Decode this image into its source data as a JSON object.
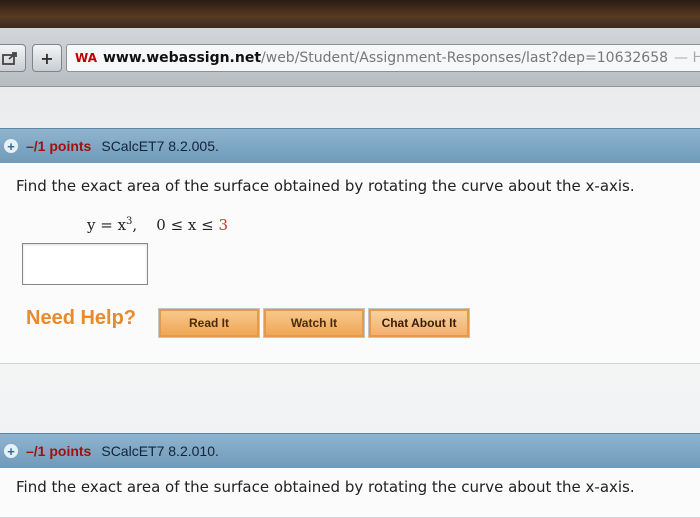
{
  "browser": {
    "url_domain": "www.webassign.net",
    "url_path": "/web/Student/Assignment-Responses/last?dep=10632658",
    "page_title_fragment": "— Ho",
    "site_icon": "WA"
  },
  "questions": [
    {
      "points": "–/1 points",
      "id": "SCalcET7 8.2.005.",
      "prompt": "Find the exact area of the surface obtained by rotating the curve about the x-axis.",
      "formula": {
        "lhs": "y = x",
        "exponent": "3",
        "comma": ",",
        "range_left": "0 ≤ x ≤",
        "range_upper": "3"
      },
      "answer_value": "",
      "help": {
        "label": "Need Help?",
        "buttons": [
          "Read It",
          "Watch It",
          "Chat About It"
        ]
      }
    },
    {
      "points": "–/1 points",
      "id": "SCalcET7 8.2.010.",
      "prompt": "Find the exact area of the surface obtained by rotating the curve about the x-axis."
    }
  ],
  "icons": {
    "share": "share-icon",
    "add_tab": "plus-icon",
    "expand": "plus-circle-icon"
  }
}
